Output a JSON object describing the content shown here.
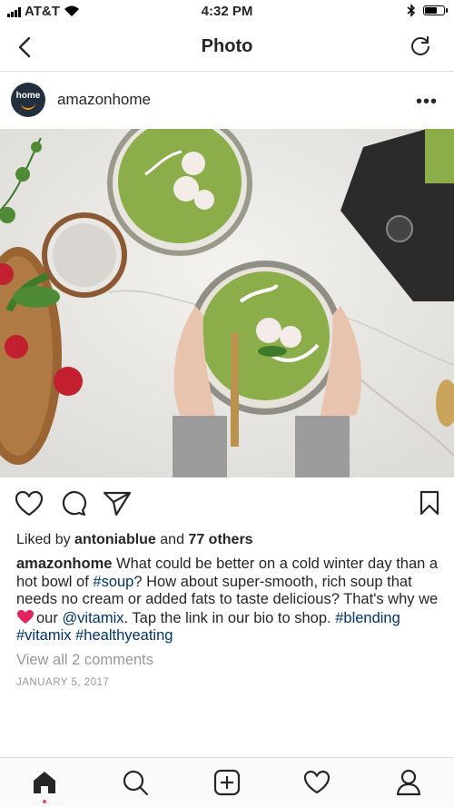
{
  "status_bar": {
    "carrier": "AT&T",
    "time": "4:32 PM"
  },
  "nav": {
    "title": "Photo"
  },
  "post": {
    "avatar_text": "home",
    "username": "amazonhome",
    "liked_by_prefix": "Liked by ",
    "liked_by_user": "antoniablue",
    "liked_by_suffix": " and ",
    "liked_by_others": "77 others",
    "caption_user": "amazonhome",
    "caption_parts": [
      " What could be better on a cold winter day than a hot bowl of ",
      "#soup",
      "? How about super-smooth, rich soup that needs no cream or added fats to taste delicious? That's why we ",
      "our ",
      "@vitamix",
      ". Tap the link in our bio to shop. ",
      "#blending",
      " ",
      "#vitamix",
      " ",
      "#healthyeating"
    ],
    "view_comments": "View all 2 comments",
    "date": "JANUARY 5, 2017"
  },
  "colors": {
    "link": "#003569",
    "notification_dot": "#ed4956",
    "heart": "#e0245e"
  }
}
